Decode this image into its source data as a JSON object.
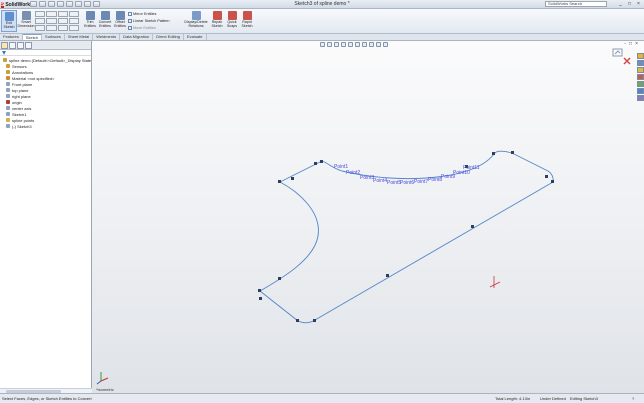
{
  "titlebar": {
    "app_name": "SolidWorks",
    "logo_letter": "S",
    "window_title": "Sketch3 of spline demo *",
    "search_placeholder": "SolidWorks Search",
    "window_controls": [
      "_",
      "□",
      "×"
    ]
  },
  "ribbon": {
    "buttons": [
      {
        "name": "exit-sketch",
        "label": "Exit Sketch"
      },
      {
        "name": "smart-dimension",
        "label": "Smart Dimension"
      },
      {
        "name": "trim-entities",
        "label": "Trim Entities"
      },
      {
        "name": "convert-entities",
        "label": "Convert Entities"
      },
      {
        "name": "offset-entities",
        "label": "Offset Entities"
      },
      {
        "name": "display-delete-relations",
        "label": "Display/Delete Relations"
      },
      {
        "name": "repair-sketch",
        "label": "Repair Sketch"
      },
      {
        "name": "quick-snaps",
        "label": "Quick Snaps"
      },
      {
        "name": "rapid-sketch",
        "label": "Rapid Sketch"
      }
    ],
    "mirror_entities": "Mirror Entities",
    "linear_sketch_pattern": "Linear Sketch Pattern",
    "move_entities": "Move Entities"
  },
  "tabs": [
    "Features",
    "Sketch",
    "Surfaces",
    "Sheet Metal",
    "Weldments",
    "Data Migration",
    "Direct Editing",
    "Evaluate"
  ],
  "active_tab": "Sketch",
  "tree": [
    {
      "label": "spline demo  (Default<<Default>_Display State",
      "level": 1,
      "icon": "part-icon",
      "color": "#c9a13a"
    },
    {
      "label": "Sensors",
      "level": 2,
      "icon": "sensor-icon",
      "color": "#c9a13a"
    },
    {
      "label": "Annotations",
      "level": 2,
      "icon": "annotations-icon",
      "color": "#c9a13a"
    },
    {
      "label": "Material <not specified>",
      "level": 2,
      "icon": "material-icon",
      "color": "#d08a2c"
    },
    {
      "label": "Front plane",
      "level": 2,
      "icon": "plane-icon",
      "color": "#8fa3c0"
    },
    {
      "label": "top plane",
      "level": 2,
      "icon": "plane-icon",
      "color": "#8fa3c0"
    },
    {
      "label": "right plane",
      "level": 2,
      "icon": "plane-icon",
      "color": "#8fa3c0"
    },
    {
      "label": "origin",
      "level": 2,
      "icon": "origin-icon",
      "color": "#b23a3a"
    },
    {
      "label": "center axis",
      "level": 2,
      "icon": "axis-icon",
      "color": "#8fa3c0"
    },
    {
      "label": "Sketch1",
      "level": 2,
      "icon": "sketch-icon",
      "color": "#8fa3c0"
    },
    {
      "label": "spline points",
      "level": 2,
      "icon": "folder-icon",
      "color": "#d7b04a"
    },
    {
      "label": "(-) Sketch3",
      "level": 2,
      "icon": "sketch-icon",
      "color": "#8fa3c0"
    }
  ],
  "graphics": {
    "view_label": "*Isometric",
    "viewport_controls": [
      "-",
      "□",
      "×"
    ],
    "point_labels": [
      "Point1",
      "Point2",
      "Point3",
      "Point4",
      "Point5",
      "Point6",
      "Point7",
      "Point8",
      "Point9",
      "Point10",
      "Point11"
    ]
  },
  "status": {
    "message": "Select Faces, Edges, or Sketch Entities to Convert",
    "total_length": "Total Length: 4.13in",
    "definition": "Under Defined",
    "editing": "Editing Sketch3",
    "help": "?"
  }
}
